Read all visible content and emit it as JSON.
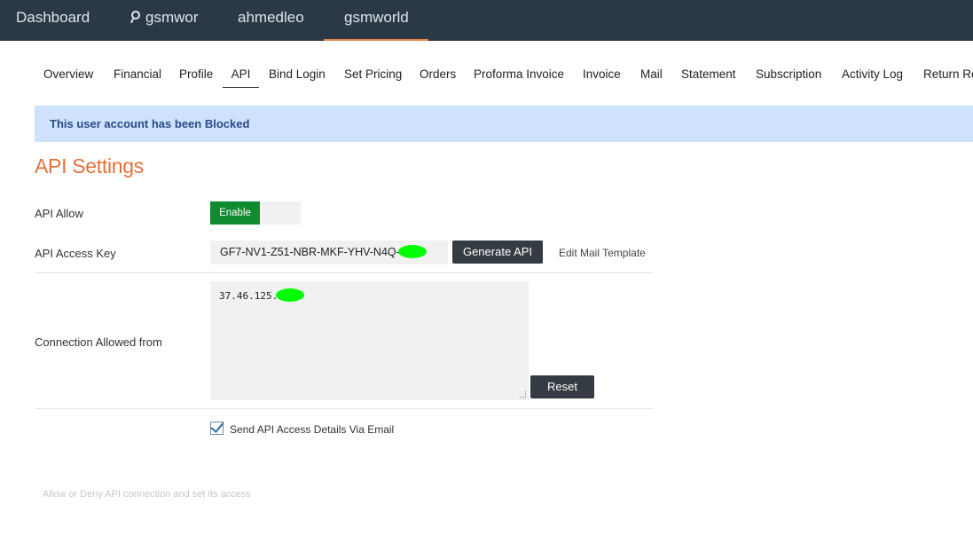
{
  "topnav": {
    "items": [
      {
        "label": "Dashboard"
      },
      {
        "label": "gsmwor",
        "icon": "search-icon"
      },
      {
        "label": "ahmedleo"
      },
      {
        "label": "gsmworld",
        "active": true
      }
    ]
  },
  "subnav": {
    "items": [
      "Overview",
      "Financial",
      "Profile",
      "API",
      "Bind Login",
      "Set Pricing",
      "Orders",
      "Proforma Invoice",
      "Invoice",
      "Mail",
      "Statement",
      "Subscription",
      "Activity Log",
      "Return Re"
    ],
    "active": "API"
  },
  "alert": {
    "text": "This user account has been Blocked"
  },
  "page": {
    "title": "API Settings"
  },
  "form": {
    "api_allow_label": "API Allow",
    "toggle_label": "Enable",
    "access_key_label": "API Access Key",
    "access_key_value": "GF7-NV1-Z51-NBR-MKF-YHV-N4Q-",
    "generate_button": "Generate API",
    "edit_mail_link": "Edit Mail Template",
    "connection_label": "Connection Allowed from",
    "connection_value": "37.46.125.",
    "reset_button": "Reset",
    "send_email_label": "Send API Access Details Via Email",
    "send_email_checked": true
  },
  "hint": "Allow or Deny API connection and set its access",
  "colors": {
    "topbar": "#2b3845",
    "active_underline": "#e8884a",
    "title": "#e3713a",
    "alert_bg": "#cfe2fd",
    "enable_green": "#0f8a2e",
    "redaction": "#00ff00"
  }
}
